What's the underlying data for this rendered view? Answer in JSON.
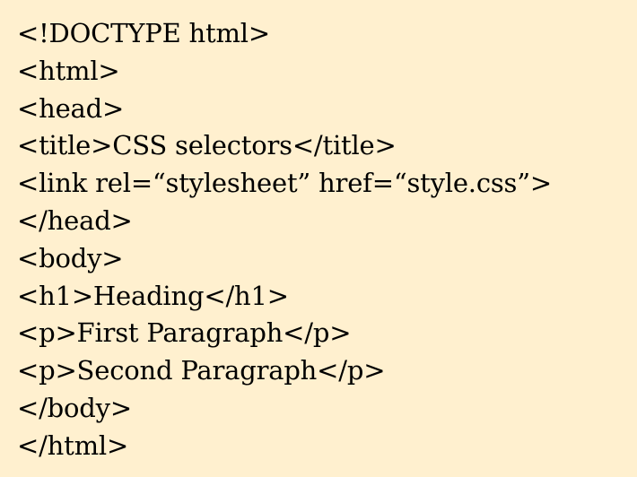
{
  "document": {
    "lines": [
      "<!DOCTYPE html>",
      "<html>",
      "<head>",
      "<title>CSS selectors</title>",
      "<link rel=“stylesheet” href=“style.css”>",
      "</head>",
      "<body>",
      "<h1>Heading</h1>",
      "<p>First Paragraph</p>",
      "<p>Second Paragraph</p>",
      "</body>",
      "</html>"
    ]
  }
}
